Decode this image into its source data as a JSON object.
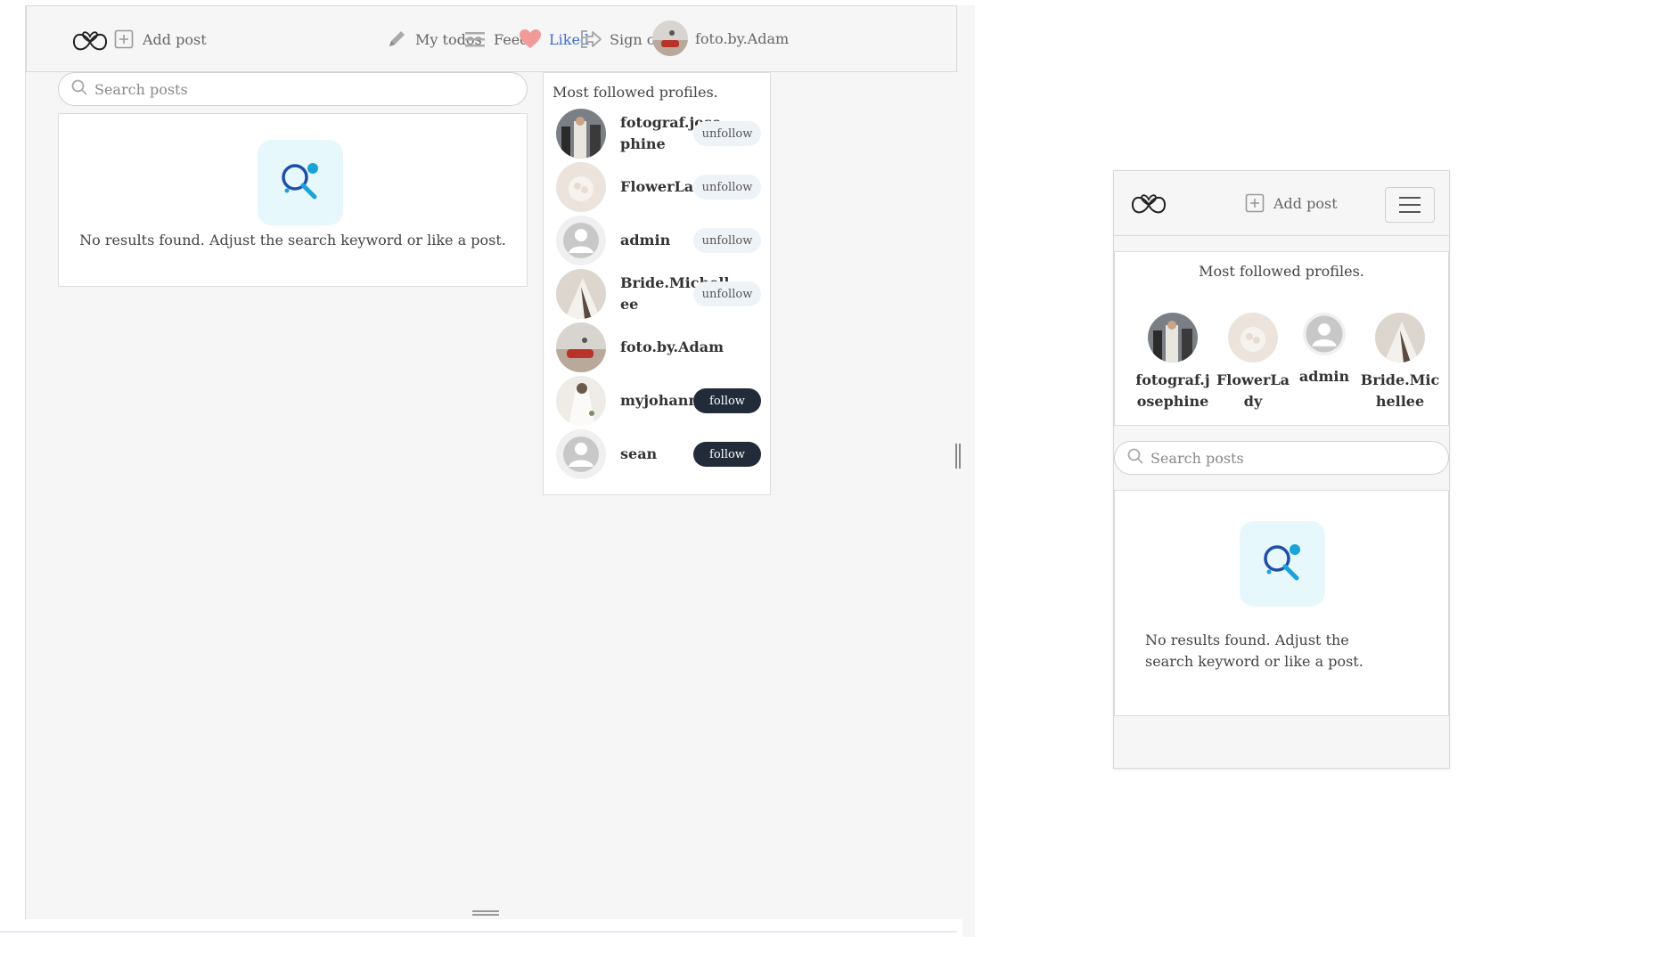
{
  "desktop": {
    "nav": {
      "add_post": "Add post",
      "my_todos": "My todos",
      "feed": "Feed",
      "liked": "Liked",
      "sign_out": "Sign out",
      "username": "foto.by.Adam"
    },
    "search": {
      "placeholder": "Search posts"
    },
    "empty_message": "No results found. Adjust the search keyword or like a post.",
    "sidebar": {
      "title": "Most followed profiles.",
      "profiles": [
        {
          "name": "fotograf.josephine",
          "button": "unfollow"
        },
        {
          "name": "FlowerLady",
          "button": "unfollow"
        },
        {
          "name": "admin",
          "button": "unfollow"
        },
        {
          "name": "Bride.Michellee",
          "button": "unfollow"
        },
        {
          "name": "foto.by.Adam",
          "button": ""
        },
        {
          "name": "myjohanna",
          "button": "follow"
        },
        {
          "name": "sean",
          "button": "follow"
        }
      ]
    }
  },
  "mobile": {
    "nav": {
      "add_post": "Add post"
    },
    "sidebar": {
      "title": "Most followed profiles.",
      "profiles": [
        {
          "name": "fotograf.josephine"
        },
        {
          "name": "FlowerLady"
        },
        {
          "name": "admin"
        },
        {
          "name": "Bride.Michellee"
        }
      ]
    },
    "search": {
      "placeholder": "Search posts"
    },
    "empty_message": "No results found. Adjust the search keyword or like a post."
  },
  "colors": {
    "active_link": "#3d6fd1",
    "liked_heart": "#f29a9a",
    "follow_button": "#222b3a",
    "unfollow_button": "#eef3f8",
    "empty_icon_bg": "#e6f8fc"
  }
}
